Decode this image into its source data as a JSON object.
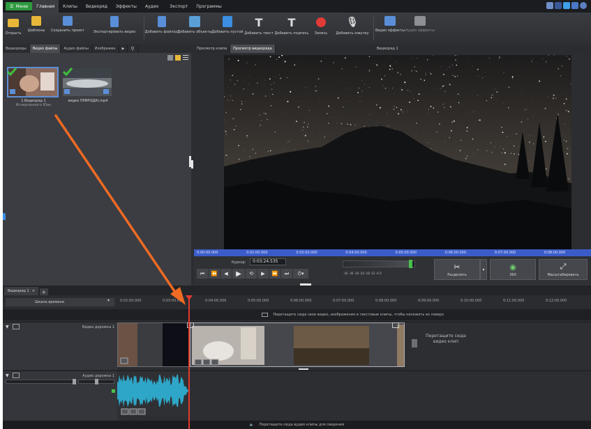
{
  "menu": {
    "button": "Меню",
    "items": [
      "Главная",
      "Клипы",
      "Видеоряд",
      "Эффекты",
      "Аудио",
      "Экспорт",
      "Программы"
    ],
    "active": "Главная"
  },
  "toolbar": {
    "tools": [
      {
        "label": "Открыть",
        "icon": "folder-icon",
        "color": "#e8b73a"
      },
      {
        "label": "Шаблоны",
        "icon": "templates-icon",
        "color": "#e8b73a"
      },
      {
        "label": "Сохранить проект",
        "icon": "save-icon",
        "color": "#5a8ed8"
      },
      {
        "label": "Экспортировать видео",
        "icon": "export-icon",
        "color": "#5a8ed8"
      },
      {
        "label": "Добавить файл(ы)",
        "icon": "add-file-icon",
        "color": "#5a8ed8"
      },
      {
        "label": "Добавить объекты",
        "icon": "add-objects-icon",
        "color": "#5aa0d8"
      },
      {
        "label": "Добавить пустой",
        "icon": "add-blank-icon",
        "color": "#3b8ee0"
      },
      {
        "label": "Добавить текст",
        "icon": "add-text-icon",
        "color": "#dcdcdc"
      },
      {
        "label": "Добавить подпись",
        "icon": "add-caption-icon",
        "color": "#dcdcdc"
      },
      {
        "label": "Запись",
        "icon": "record-icon",
        "color": "#e23a36"
      },
      {
        "label": "Добавить озвучку",
        "icon": "voiceover-icon",
        "color": "#dcdcdc"
      },
      {
        "label": "Видео эффекты",
        "icon": "video-effects-icon",
        "color": "#5a8ed8"
      },
      {
        "label": "Аудио эффекты",
        "icon": "audio-effects-icon",
        "color": "#8d8f94"
      }
    ]
  },
  "left_panel": {
    "tabs": [
      "Видеоряды",
      "Видео файлы",
      "Аудио файлы",
      "Изображен"
    ],
    "active_tab": "Видео файлы",
    "items": [
      {
        "label_line1": "1.Видеоряд 1",
        "label_line2": "Исчерпанного Юан",
        "selected": true
      },
      {
        "label_line1": "видео ПРИРОДА).mp4",
        "label_line2": "",
        "selected": false
      }
    ]
  },
  "preview": {
    "tabs": [
      "Просмотр клипа",
      "Просмотр видеоряда"
    ],
    "active_tab": "Просмотр видеоряда",
    "title": "Видеоряд 1",
    "ruler_times": [
      "0:00:00.000",
      "0:02:00.000",
      "0:03:00.000",
      "0:04:00.000",
      "0:05:00.000",
      "0:06:00.000",
      "0:07:00.000",
      "0:08:00.000"
    ],
    "cursor_label": "Курсор:",
    "cursor_value": "0:03:24.535",
    "volume_scale": "-42 -36 -30 -24 -18 -12 -6 0",
    "volume_fraction": 0.95,
    "split_label": "Разделить",
    "view_360_label": "360",
    "fullscreen_label": "Масштабировать"
  },
  "timeline": {
    "sequence_tab": "Видеоряд 1",
    "scale_label": "Шкала времени",
    "ticks": [
      "0:02:00.000",
      "0:03:00.000",
      "0:04:00.000",
      "0:05:00.000",
      "0:06:00.000",
      "0:07:00.000",
      "0:08:00.000",
      "0:09:00.000",
      "0:10:00.000",
      "0:11:00.000",
      "0:12:00.000"
    ],
    "overlay_hint": "Перетащите сюда свои видео, изображения и текстовые клипы, чтобы наложить их поверх",
    "video_track_name": "Видео дорожка 1",
    "video_drop_hint_line1": "Перетащите сюда",
    "video_drop_hint_line2": "видео клип",
    "audio_track_name": "Аудио дорожка 1",
    "audio_drop_hint": "Перетащите сюда аудио клипы для сведения"
  }
}
